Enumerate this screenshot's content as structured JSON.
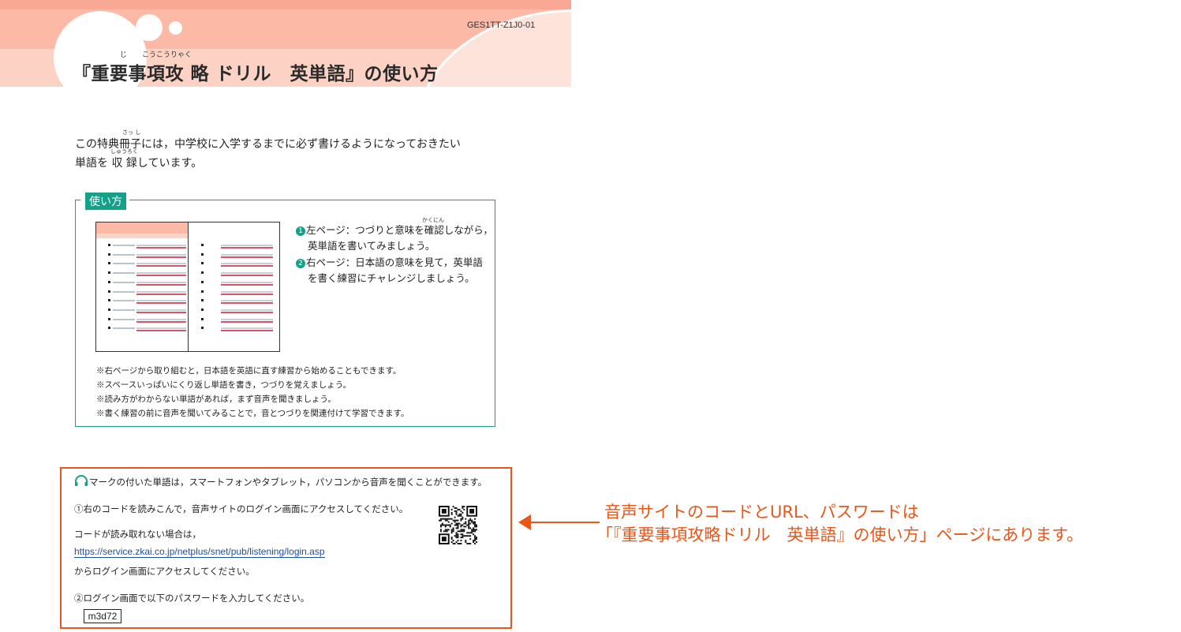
{
  "header": {
    "code": "GES1TT-Z1J0-01",
    "title": "『重要事項攻 略 ドリル　英単語』の使い方",
    "title_ruby": "じ",
    "title_ruby2": "こうこうりゃく"
  },
  "intro": {
    "line1": "この特典冊子には，中学校に入学するまでに必ず書けるようになっておきたい",
    "line2": "単語を 収 録しています。",
    "ruby1": "さっ し",
    "ruby2": "しゅうろく"
  },
  "usage": {
    "label": "使い方",
    "step1_num": "1",
    "step1": "左ページ：つづりと意味を確認しながら，",
    "step1_ruby": "かくにん",
    "step1_cont": "英単語を書いてみましょう。",
    "step2_num": "2",
    "step2": "右ページ：日本語の意味を見て，英単語",
    "step2_cont": "を書く練習にチャレンジしましょう。",
    "notes": [
      "※右ページから取り組むと，日本語を英語に直す練習から始めることもできます。",
      "※スペースいっぱいにくり返し単語を書き，つづりを覚えましょう。",
      "※読み方がわからない単語があれば，まず音声を聞きましょう。",
      "※書く練習の前に音声を聞いてみることで，音とつづりを関連付けて学習できます。"
    ]
  },
  "audio": {
    "intro": "マークの付いた単語は，スマートフォンやタブレット，パソコンから音声を聞くことができます。",
    "step1": "①右のコードを読みこんで，音声サイトのログイン画面にアクセスしてください。",
    "fallback": "コードが読み取れない場合は，",
    "url": "https://service.zkai.co.jp/netplus/snet/pub/listening/login.asp",
    "url_after": "からログイン画面にアクセスしてください。",
    "step2": "②ログイン画面で以下のパスワードを入力してください。",
    "password": "m3d72"
  },
  "callout": {
    "line1": "音声サイトのコードとURL、パスワードは",
    "line2": "「『重要事項攻略ドリル　英単語』の使い方」ページにあります。"
  },
  "colors": {
    "header_pink": "#fbb9a6",
    "teal": "#14a089",
    "orange": "#e8561a",
    "link_blue": "#1f4e9c"
  },
  "icons": [
    "headphone-icon",
    "qr-code-icon",
    "arrow-left-icon"
  ]
}
